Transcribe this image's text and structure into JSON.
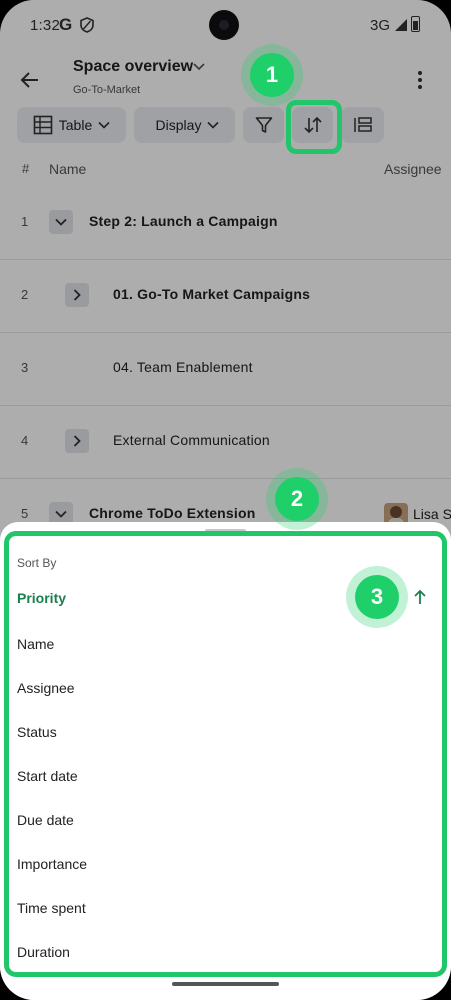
{
  "statusbar": {
    "time": "1:32",
    "g": "G",
    "network": "3G"
  },
  "header": {
    "title": "Space overview",
    "subtitle": "Go-To-Market"
  },
  "toolbar": {
    "table_label": "Table",
    "display_label": "Display"
  },
  "columns": {
    "hash": "#",
    "name": "Name",
    "assignee": "Assignee"
  },
  "rows": [
    {
      "num": "1",
      "label": "Step 2: Launch a Campaign",
      "toggle": "expanded"
    },
    {
      "num": "2",
      "label": "01. Go-To Market Campaigns",
      "toggle": "collapsed"
    },
    {
      "num": "3",
      "label": "04. Team Enablement",
      "toggle": "none"
    },
    {
      "num": "4",
      "label": "External Communication",
      "toggle": "collapsed"
    },
    {
      "num": "5",
      "label": "Chrome ToDo Extension",
      "toggle": "expanded",
      "assignee": "Lisa S"
    }
  ],
  "sort_sheet": {
    "title": "Sort By",
    "items": [
      "Priority",
      "Name",
      "Assignee",
      "Status",
      "Start date",
      "Due date",
      "Importance",
      "Time spent",
      "Duration"
    ],
    "active": "Priority",
    "direction": "ascending"
  },
  "badges": {
    "one": "1",
    "two": "2",
    "three": "3"
  },
  "colors": {
    "highlight": "#21c66a",
    "active_text": "#1b7f4b",
    "button_bg": "#eceef2"
  }
}
